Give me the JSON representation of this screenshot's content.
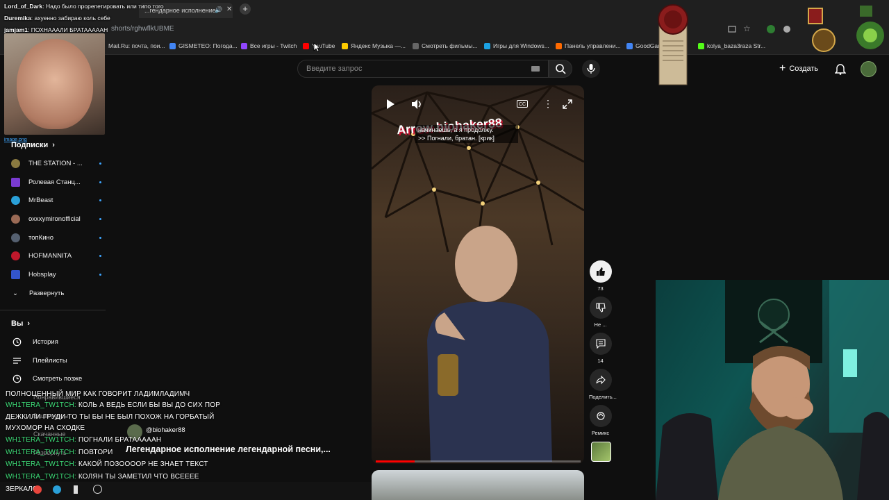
{
  "browser": {
    "tabs": [
      {
        "label": "...гендарное исполнение"
      },
      {
        "label": ""
      }
    ],
    "new_tab_label": "+",
    "url": "shorts/rghwflkUBME",
    "bookmarks": [
      {
        "label": "Mail.Ru: почта, пои...",
        "color": "#168de2"
      },
      {
        "label": "GISMETEO: Погода...",
        "color": "#4285f4"
      },
      {
        "label": "Все игры - Twitch",
        "color": "#9146ff"
      },
      {
        "label": "YouTube",
        "color": "#ff0000"
      },
      {
        "label": "Яндекс Музыка —...",
        "color": "#ffcc00"
      },
      {
        "label": "Смотреть фильмы...",
        "color": "#666666"
      },
      {
        "label": "Игры для Windows...",
        "color": "#1ba1e2"
      },
      {
        "label": "Панель управлени...",
        "color": "#ff6a00"
      },
      {
        "label": "GoodGam...",
        "color": "#4285f4"
      },
      {
        "label": "kolya_baza3raza Str...",
        "color": "#53fc18"
      }
    ]
  },
  "header": {
    "search_placeholder": "Введите запрос",
    "create_label": "Создать"
  },
  "top_chat": [
    {
      "user": "Lord_of_Dark",
      "text": "Надо было прорепетировать или типо того"
    },
    {
      "user": "Duremika",
      "text": "ахуенно забираю коль себе"
    },
    {
      "user": "jamjam1",
      "text": "ПОХНАААЛИ БРАТАААААН"
    }
  ],
  "webcam1_label": "image.png",
  "sidebar": {
    "subscriptions_title": "Подписки",
    "subscriptions": [
      {
        "label": "THE STATION - ...",
        "color": "#8a7a40"
      },
      {
        "label": "Ролевая Станц...",
        "color": "#7a3bd1"
      },
      {
        "label": "MrBeast",
        "color": "#2aa0d8"
      },
      {
        "label": "oxxxymironofficial",
        "color": "#9a6a55"
      },
      {
        "label": "топКино",
        "color": "#556070"
      },
      {
        "label": "HOFMANNITA",
        "color": "#c0182b"
      },
      {
        "label": "Hobsplay",
        "color": "#3355cc"
      }
    ],
    "expand_label": "Развернуть",
    "you_title": "Вы",
    "you_items": [
      {
        "label": "История"
      },
      {
        "label": "Плейлисты"
      },
      {
        "label": "Смотреть позже"
      }
    ],
    "ghost_items": [
      "Понравившиеся",
      "Ваши курсы",
      "Скачанные",
      "Развернуть"
    ]
  },
  "player": {
    "brand_overlay": "Arrow      biohaker88",
    "caption_line1": "начинаешь, а я продолжу.",
    "caption_line2": ">> Погнали, братан. [крик]",
    "cc_label": "CC",
    "progress": 0.19
  },
  "actions": [
    {
      "name": "like",
      "label": "73"
    },
    {
      "name": "dislike",
      "label": "Не ..."
    },
    {
      "name": "comments",
      "label": "14"
    },
    {
      "name": "share",
      "label": "Поделить..."
    },
    {
      "name": "remix",
      "label": "Ремикс"
    }
  ],
  "channel": {
    "name": "@biohaker88"
  },
  "video_title": "Легендарное исполнение легендарной песни,...",
  "stream_chat": [
    {
      "user": "",
      "text": "ПОЛНОЦЕННЫЙ МИР КАК ГОВОРИТ ЛАДИМЛАДИМЧ"
    },
    {
      "user": "WH1TERA_TW1TCH:",
      "text": "КОЛЬ А ВЕДЬ ЕСЛИ БЫ ВЫ ДО СИХ ПОР"
    },
    {
      "user": "",
      "text": "ДЕЖКИЛИ ГРУДИ ТО ТЫ БЫ НЕ БЫЛ ПОХОЖ НА ГОРБАТЫЙ"
    },
    {
      "user": "",
      "text": "МУХОМОР НА СХОДКЕ"
    },
    {
      "user": "WH1TERA_TW1TCH:",
      "text": "ПОГНАЛИ БРАТАААААН"
    },
    {
      "user": "WH1TERA_TW1TCH:",
      "text": "ПОВТОРИ"
    },
    {
      "user": "WH1TERA_TW1TCH:",
      "text": "КАКОЙ ПОЗООООР НЕ ЗНАЕТ ТЕКСТ"
    },
    {
      "user": "WH1TERA_TW1TCH:",
      "text": "КОЛЯН ТЫ ЗАМЕТИЛ ЧТО ВСЕЕЕЕ"
    }
  ],
  "taskbar_label": "ЗЕРКАЛО"
}
